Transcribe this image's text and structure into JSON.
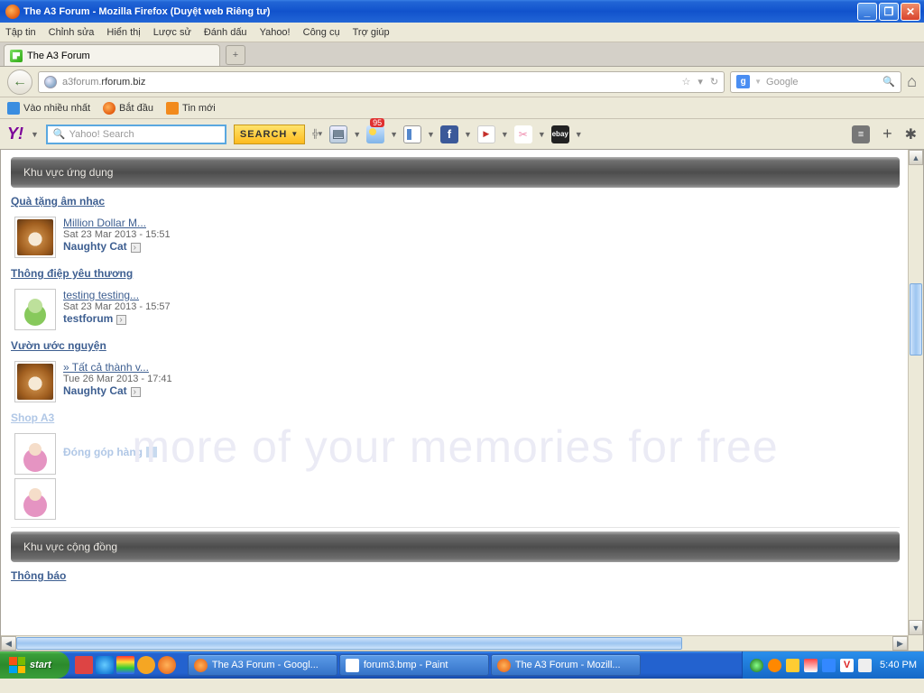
{
  "window": {
    "title": "The A3 Forum - Mozilla Firefox (Duyệt web Riêng tư)"
  },
  "menu": {
    "items": [
      "Tập tin",
      "Chỉnh sửa",
      "Hiển thị",
      "Lược sử",
      "Đánh dấu",
      "Yahoo!",
      "Công cụ",
      "Trợ giúp"
    ]
  },
  "tab": {
    "label": "The A3 Forum",
    "plus": "+"
  },
  "nav": {
    "url_prefix": "a3forum.",
    "url_domain": "rforum.biz",
    "search_placeholder": "Google",
    "search_letter": "g",
    "star": "☆",
    "dropdown": "▾",
    "reload": "↻",
    "home": "⌂",
    "back": "←"
  },
  "bookmarks": {
    "items": [
      "Vào nhiều nhất",
      "Bắt đầu",
      "Tin mới"
    ]
  },
  "yahoo": {
    "logo": "Y!",
    "search_placeholder": "Yahoo! Search",
    "btn": "SEARCH",
    "badge": "95",
    "ebay": "ebay",
    "fb": "f",
    "menu": "≡",
    "plus": "+",
    "gear": "✱"
  },
  "page": {
    "watermark": "more of your memories for free",
    "sections": [
      {
        "title": "Khu vực ứng dụng",
        "forums": [
          {
            "name": "Quà tặng âm nhạc",
            "cls": "",
            "post": {
              "title": "Million Dollar M...",
              "date": "Sat 23 Mar 2013 - 15:51",
              "user": "Naughty Cat",
              "av": "coffee"
            }
          },
          {
            "name": "Thông điệp yêu thương",
            "cls": "",
            "post": {
              "title": "testing testing...",
              "date": "Sat 23 Mar 2013 - 15:57",
              "user": "testforum",
              "av": "user-g"
            }
          },
          {
            "name": "Vườn ước nguyện",
            "cls": "",
            "post": {
              "title": "» Tất cả thành v...",
              "date": "Tue 26 Mar 2013 - 17:41",
              "user": "Naughty Cat",
              "av": "coffee"
            }
          },
          {
            "name": "Shop A3",
            "cls": "shop",
            "post": {
              "title": "Đóng góp hàng",
              "title_cls": "shop",
              "date": "",
              "user": "",
              "av": "user-p",
              "second_av": "user-p"
            }
          }
        ]
      },
      {
        "title": "Khu vực cộng đồng",
        "forums": [
          {
            "name": "Thông báo",
            "cls": ""
          }
        ]
      }
    ]
  },
  "taskbar": {
    "start": "start",
    "buttons": [
      "The A3 Forum - Googl...",
      "forum3.bmp - Paint",
      "The A3 Forum - Mozill..."
    ],
    "clock": "5:40 PM"
  }
}
